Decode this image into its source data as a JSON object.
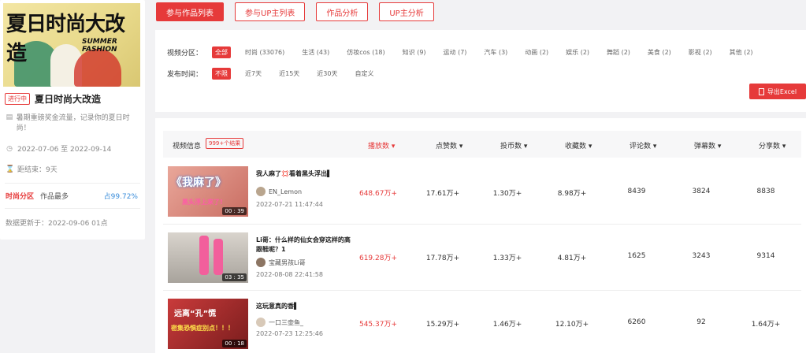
{
  "event": {
    "cover_title": "夏日时尚大改造",
    "cover_subtitle": "SUMMER FASHION",
    "status": "进行中",
    "title": "夏日时尚大改造",
    "description": "暑期重磅奖金流量，记录你的夏日时尚！",
    "date_range": "2022-07-06 至 2022-09-14",
    "countdown": "距结束：9天",
    "category_label": "时尚分区",
    "category_mid": "作品最多",
    "category_pct": "占99.72%",
    "updated": "数据更新于：2022-09-06 01点"
  },
  "tabs": [
    {
      "label": "参与作品列表",
      "active": true
    },
    {
      "label": "参与UP主列表",
      "active": false
    },
    {
      "label": "作品分析",
      "active": false
    },
    {
      "label": "UP主分析",
      "active": false
    }
  ],
  "filters": {
    "category_label": "视频分区：",
    "categories": [
      "全部",
      "时尚 (33076)",
      "生活 (43)",
      "仿妆cos (18)",
      "知识 (9)",
      "运动 (7)",
      "汽车 (3)",
      "动画 (2)",
      "娱乐 (2)",
      "舞蹈 (2)",
      "美食 (2)",
      "影视 (2)",
      "其他 (2)"
    ],
    "time_label": "发布时间：",
    "times": [
      "不限",
      "近7天",
      "近15天",
      "近30天",
      "自定义"
    ],
    "export_label": "导出Excel"
  },
  "table": {
    "headers": {
      "info": "视频信息",
      "count": "999+个结果",
      "play": "播放数 ▾",
      "like": "点赞数 ▾",
      "coin": "投币数 ▾",
      "fav": "收藏数 ▾",
      "comment": "评论数 ▾",
      "danmaku": "弹幕数 ▾",
      "share": "分享数 ▾"
    },
    "rows": [
      {
        "title": "我人麻了💢看着黑头浮出▌",
        "author": "EN_Lemon",
        "date": "2022-07-21 11:47:44",
        "duration": "00 : 39",
        "thumb_text": "《我麻了》",
        "thumb_sub": "黑头浮上来了!",
        "play": "648.67万+",
        "like": "17.61万+",
        "coin": "1.30万+",
        "fav": "8.98万+",
        "comment": "8439",
        "danmaku": "3824",
        "share": "8838"
      },
      {
        "title": "Li哥：什么样的仙女会穿这样的高跟鞋呢？1",
        "author": "宝藏男孩Li哥",
        "date": "2022-08-08 22:41:58",
        "duration": "03 : 35",
        "thumb_text": "",
        "thumb_sub": "",
        "play": "619.28万+",
        "like": "17.78万+",
        "coin": "1.33万+",
        "fav": "4.81万+",
        "comment": "1625",
        "danmaku": "3243",
        "share": "9314"
      },
      {
        "title": "这玩意真的香▌",
        "author": "一口三壶鱼_",
        "date": "2022-07-23 12:25:46",
        "duration": "00 : 18",
        "thumb_text": "远离“孔”慌",
        "thumb_sub": "密集恐惧症别点！！！",
        "play": "545.37万+",
        "like": "15.29万+",
        "coin": "1.46万+",
        "fav": "12.10万+",
        "comment": "6260",
        "danmaku": "92",
        "share": "1.64万+"
      }
    ]
  }
}
